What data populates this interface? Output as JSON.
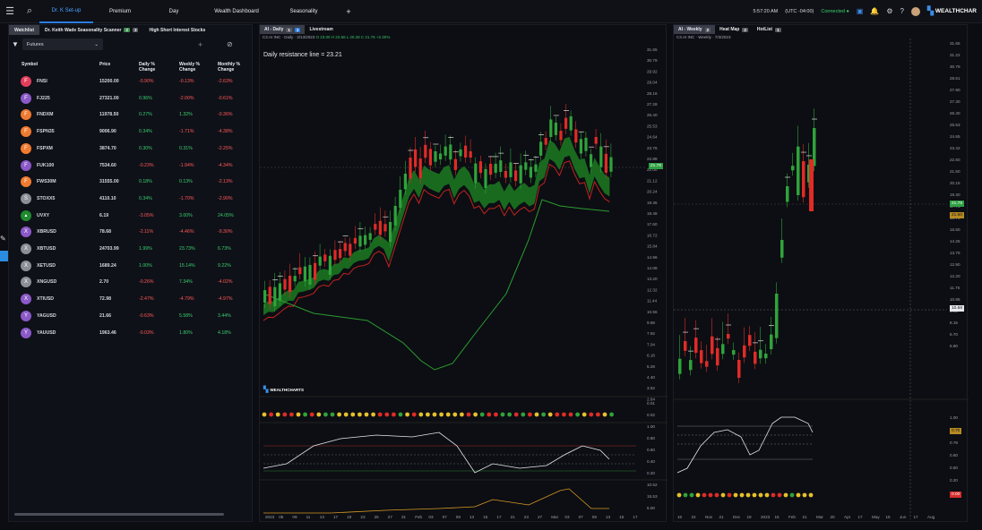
{
  "topbar": {
    "tabs": [
      "Dr. K Set-up",
      "Premium",
      "Day",
      "Wealth Dashboard",
      "Seasonality"
    ],
    "add_tab": "+",
    "time": "5:57:20 AM",
    "timezone": "(UTC -04:00)",
    "status": "Connected",
    "brand": "WEALTHCHAR"
  },
  "watchlist": {
    "tabs": [
      "Watchlist",
      "Dr. Keith Wade Seasonality Scanner",
      "High Short Interest Stocks"
    ],
    "badges": [
      "2",
      "3"
    ],
    "filter": "Futures",
    "headers": {
      "symbol": "Symbol",
      "price": "Price",
      "daily": "Daily % Change",
      "weekly": "Weekly % Change",
      "monthly": "Monthly % Change"
    },
    "rows": [
      {
        "l": "F",
        "s": "FNSI",
        "p": "15200.00",
        "d": "-0.90%",
        "w": "-0.13%",
        "m": "-2.63%",
        "c": "#e23e5b"
      },
      {
        "l": "F",
        "s": "FJ225",
        "p": "27321.00",
        "d": "0.96%",
        "w": "-2.00%",
        "m": "-0.61%",
        "c": "#8b59c8"
      },
      {
        "l": "F",
        "s": "FNDXM",
        "p": "11978.50",
        "d": "0.27%",
        "w": "1.32%",
        "m": "-0.36%",
        "c": "#f07a2f"
      },
      {
        "l": "F",
        "s": "FSPN35",
        "p": "9006.90",
        "d": "0.34%",
        "w": "-1.71%",
        "m": "-4.38%",
        "c": "#f07a2f"
      },
      {
        "l": "F",
        "s": "FSPXM",
        "p": "3874.70",
        "d": "0.30%",
        "w": "0.31%",
        "m": "-2.25%",
        "c": "#f07a2f"
      },
      {
        "l": "F",
        "s": "FUK100",
        "p": "7534.60",
        "d": "-0.23%",
        "w": "-1.94%",
        "m": "-4.34%",
        "c": "#8b59c8"
      },
      {
        "l": "F",
        "s": "FWS30M",
        "p": "31555.00",
        "d": "0.18%",
        "w": "0.13%",
        "m": "-2.13%",
        "c": "#f07a2f"
      },
      {
        "l": "S",
        "s": "STOXX5",
        "p": "4110.10",
        "d": "0.34%",
        "w": "-1.70%",
        "m": "-2.90%",
        "c": "#8b8f97"
      },
      {
        "l": "",
        "s": "UVXY",
        "p": "6.19",
        "d": "-3.05%",
        "w": "3.00%",
        "m": "24.05%",
        "c": "#1f8a2e"
      },
      {
        "l": "X",
        "s": "XBRUSD",
        "p": "78.68",
        "d": "-2.11%",
        "w": "-4.46%",
        "m": "-9.30%",
        "c": "#8b59c8"
      },
      {
        "l": "X",
        "s": "XBTUSD",
        "p": "24703.99",
        "d": "1.99%",
        "w": "23.73%",
        "m": "6.73%",
        "c": "#8b8f97"
      },
      {
        "l": "X",
        "s": "XETUSD",
        "p": "1689.24",
        "d": "1.00%",
        "w": "15.14%",
        "m": "9.22%",
        "c": "#8b8f97"
      },
      {
        "l": "X",
        "s": "XNGUSD",
        "p": "2.70",
        "d": "-0.26%",
        "w": "7.34%",
        "m": "-4.02%",
        "c": "#8b8f97"
      },
      {
        "l": "X",
        "s": "XTIUSD",
        "p": "72.98",
        "d": "-2.47%",
        "w": "-4.79%",
        "m": "-4.97%",
        "c": "#8b59c8"
      },
      {
        "l": "Y",
        "s": "YAGUSD",
        "p": "21.66",
        "d": "-0.63%",
        "w": "5.58%",
        "m": "3.44%",
        "c": "#8b59c8"
      },
      {
        "l": "Y",
        "s": "YAUUSD",
        "p": "1963.46",
        "d": "-0.03%",
        "w": "1.80%",
        "m": "4.18%",
        "c": "#8b59c8"
      }
    ]
  },
  "chart_daily": {
    "tabs": [
      "AI - Daily",
      "Livestream"
    ],
    "badges": [
      "1",
      "1"
    ],
    "symbol_line": "C3.AI INC · Daily · 3/13/2023",
    "ohlc": "O 23.00 H 23.56 L 20.28 C 21.76 +2.30%",
    "resistance": "Daily resistance line = 23.21",
    "price_tag": "21.76",
    "brand": "WEALTHCHARTS",
    "y_ticks": [
      "31.65",
      "30.79",
      "29.92",
      "29.04",
      "28.16",
      "27.28",
      "26.40",
      "25.53",
      "24.64",
      "23.76",
      "22.88",
      "22.00",
      "21.12",
      "20.24",
      "19.36",
      "18.48",
      "17.60",
      "16.72",
      "15.84",
      "14.96",
      "14.08",
      "13.20",
      "12.32",
      "11.44",
      "10.56",
      "9.68",
      "7.92",
      "7.04",
      "6.16",
      "5.28",
      "4.40",
      "3.52",
      "2.64"
    ],
    "x_ticks": [
      "2023",
      "05",
      "09",
      "11",
      "13",
      "17",
      "19",
      "23",
      "25",
      "27",
      "31",
      "Feb",
      "03",
      "07",
      "09",
      "13",
      "15",
      "17",
      "21",
      "23",
      "27",
      "Mar",
      "03",
      "07",
      "09",
      "13",
      "15",
      "17"
    ],
    "osc_ticks": [
      "0.01",
      "0.02",
      "1.00",
      "0.80",
      "0.60",
      "0.40",
      "0.20",
      "10.52",
      "15.53",
      "5.00"
    ]
  },
  "chart_weekly": {
    "tabs": [
      "AI - Weekly",
      "Heat Map",
      "HotList"
    ],
    "badges": [
      "2",
      "2",
      "1"
    ],
    "symbol_line": "C3.AI INC · Weekly · 7/3/2023",
    "price_tag": "21.76",
    "price_tag2": "21.60",
    "cross_tag": "10.68",
    "y_ticks": [
      "31.65",
      "31.22",
      "30.79",
      "28.61",
      "27.90",
      "27.30",
      "26.40",
      "25.53",
      "24.65",
      "23.42",
      "22.60",
      "21.50",
      "20.15",
      "19.30",
      "17.70",
      "16.70",
      "15.60",
      "14.25",
      "13.75",
      "12.90",
      "12.20",
      "11.75",
      "10.85",
      "9.95",
      "8.15",
      "6.70",
      "5.90"
    ],
    "x_ticks": [
      "16",
      "24",
      "Nov",
      "21",
      "Dec",
      "19",
      "2023",
      "16",
      "Feb",
      "21",
      "Mar",
      "20",
      "Apr",
      "17",
      "May",
      "15",
      "Jun",
      "17",
      "Aug"
    ],
    "osc_ticks": [
      "1.00",
      "0.80",
      "0.79",
      "0.60",
      "0.50",
      "0.20",
      "0.00"
    ],
    "osc_tag": "0.70",
    "osc_tag2": "0.00"
  }
}
